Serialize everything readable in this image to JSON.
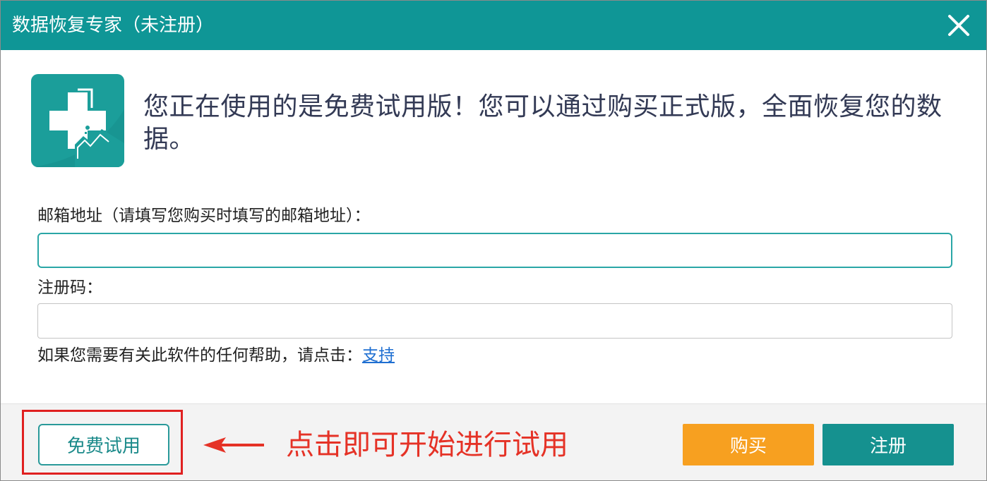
{
  "window": {
    "title": "数据恢复专家（未注册）"
  },
  "message": {
    "headline": "您正在使用的是免费试用版！您可以通过购买正式版，全面恢复您的数据。"
  },
  "form": {
    "email_label": "邮箱地址（请填写您购买时填写的邮箱地址）：",
    "email_value": "",
    "code_label": "注册码：",
    "code_value": ""
  },
  "help": {
    "text": "如果您需要有关此软件的任何帮助，请点击：",
    "link_label": "支持"
  },
  "footer": {
    "trial_label": "免费试用",
    "buy_label": "购买",
    "register_label": "注册"
  },
  "annotation": {
    "text": "点击即可开始进行试用"
  },
  "colors": {
    "titlebar": "#0f9696",
    "buy_button": "#f7a020",
    "register_button": "#15918f",
    "annotation": "#e53226"
  },
  "icons": {
    "close": "close-icon",
    "logo": "app-logo-icon",
    "arrow": "arrow-left-icon"
  }
}
